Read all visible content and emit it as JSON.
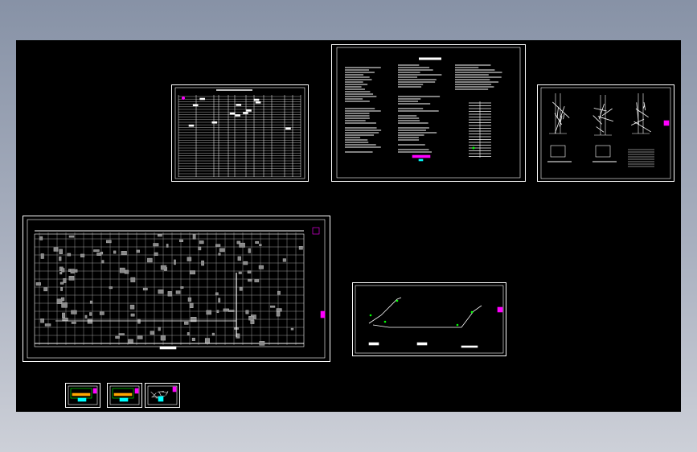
{
  "viewer": {
    "background_color": "#000000",
    "line_color": "#ffffff",
    "accent_magenta": "#ff00ff",
    "accent_green": "#00ff00",
    "accent_cyan": "#00ffff"
  },
  "sheets": [
    {
      "type": "table"
    },
    {
      "type": "notes"
    },
    {
      "type": "details"
    },
    {
      "type": "floor-plan"
    },
    {
      "type": "pipe-diagram"
    },
    {
      "type": "thumbnail"
    },
    {
      "type": "thumbnail"
    },
    {
      "type": "thumbnail"
    }
  ]
}
